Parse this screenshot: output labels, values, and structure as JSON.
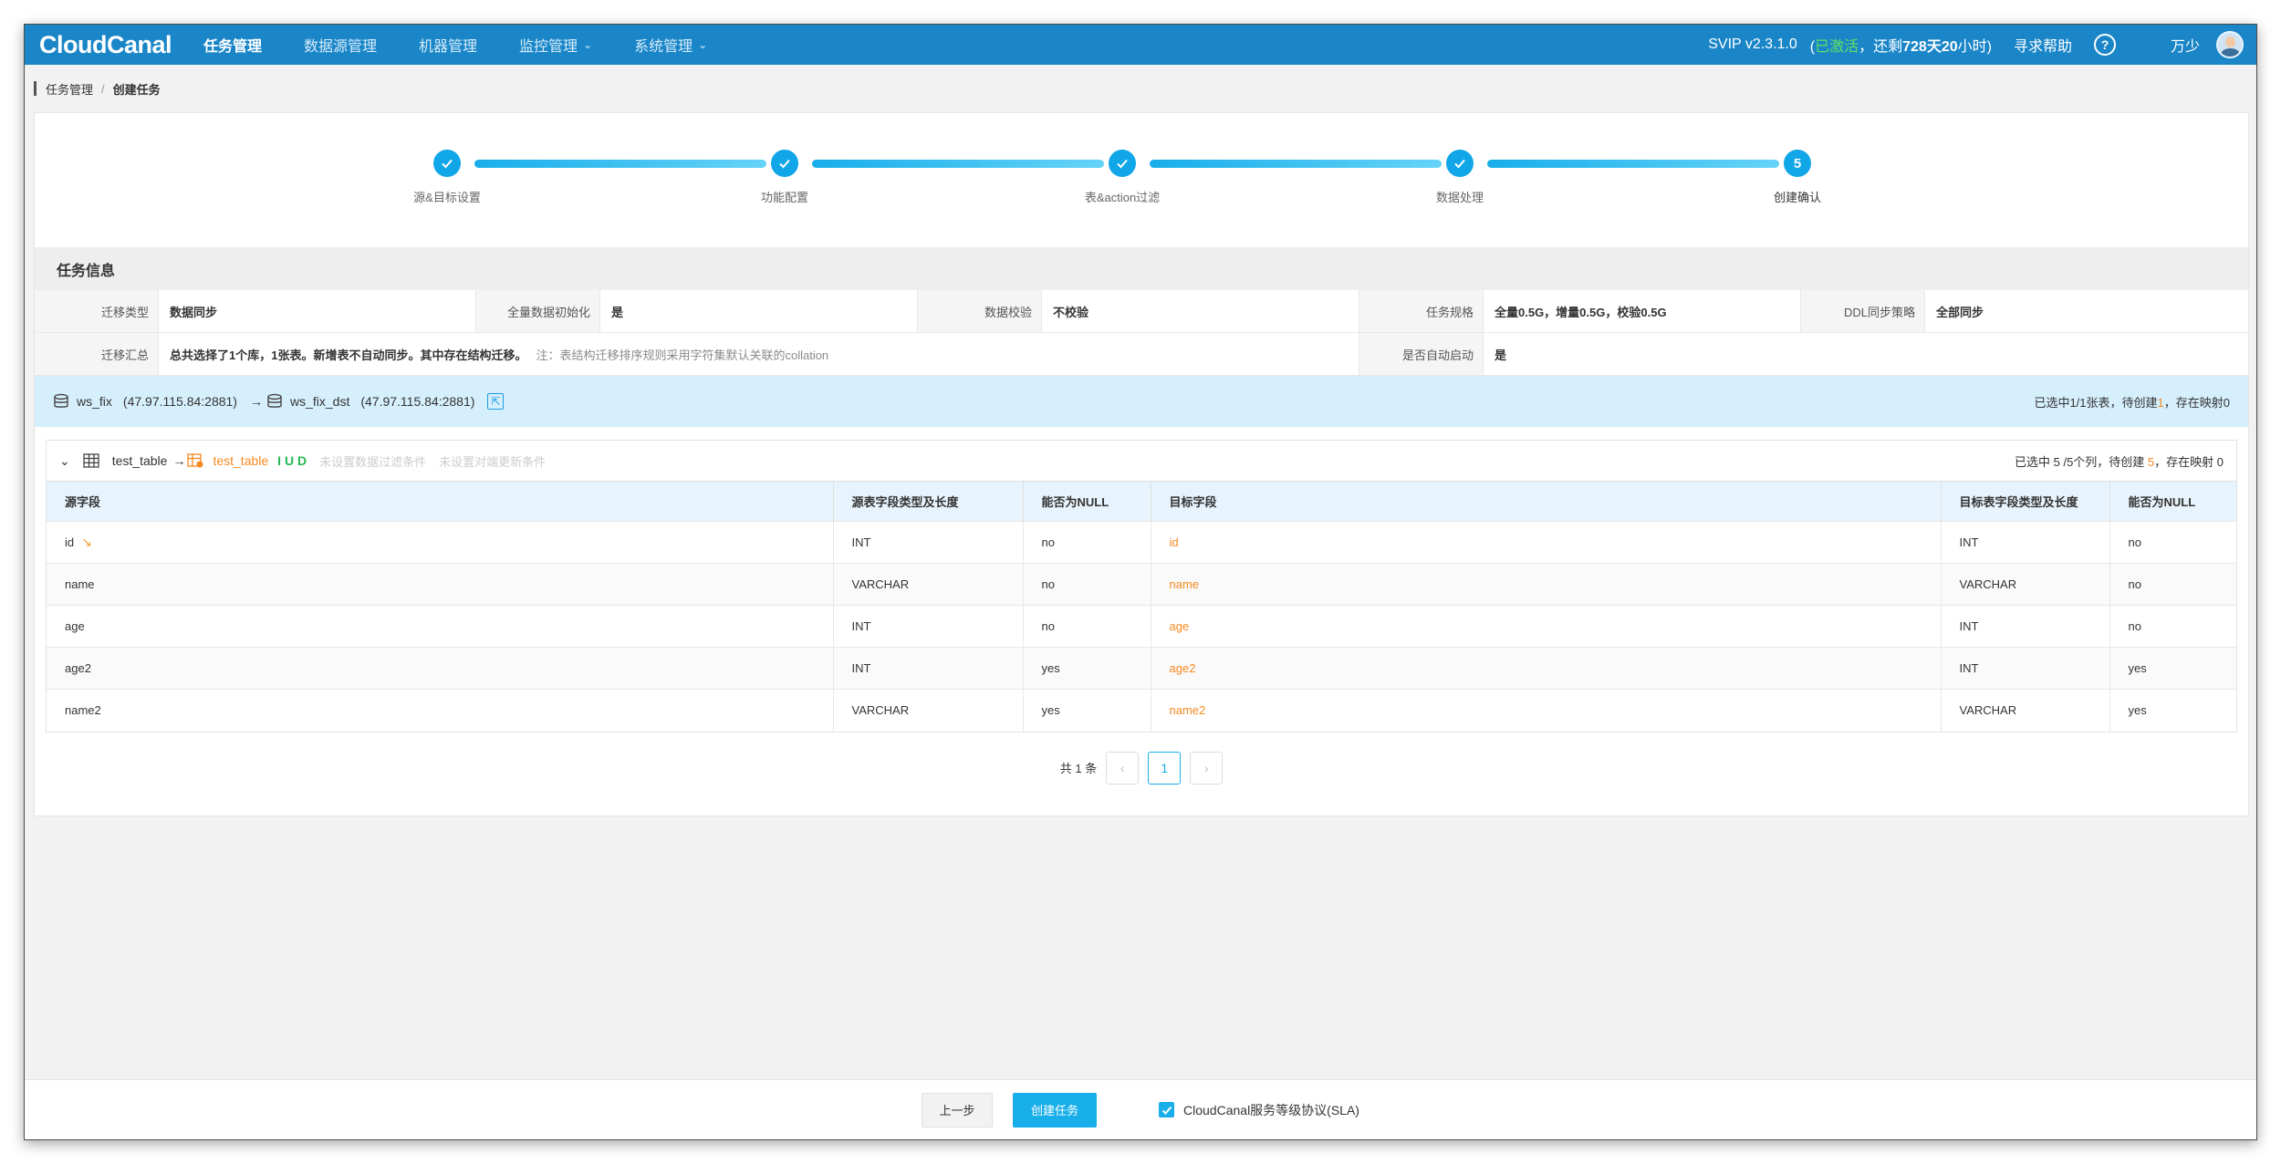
{
  "nav": {
    "logo": "CloudCanal",
    "items": [
      {
        "label": "任务管理",
        "active": true,
        "dropdown": false
      },
      {
        "label": "数据源管理",
        "active": false,
        "dropdown": false
      },
      {
        "label": "机器管理",
        "active": false,
        "dropdown": false
      },
      {
        "label": "监控管理",
        "active": false,
        "dropdown": true
      },
      {
        "label": "系统管理",
        "active": false,
        "dropdown": true
      }
    ],
    "version": "SVIP v2.3.1.0",
    "license_open": "(",
    "license_status": "已激活",
    "license_mid": "，还剩",
    "license_days": "728天20",
    "license_end": "小时)",
    "help": "寻求帮助",
    "help_icon": "?",
    "user": "万少"
  },
  "breadcrumb": {
    "parent": "任务管理",
    "separator": "/",
    "current": "创建任务"
  },
  "steps": [
    {
      "label": "源&目标设置",
      "done": true,
      "num": ""
    },
    {
      "label": "功能配置",
      "done": true,
      "num": ""
    },
    {
      "label": "表&action过滤",
      "done": true,
      "num": ""
    },
    {
      "label": "数据处理",
      "done": true,
      "num": ""
    },
    {
      "label": "创建确认",
      "done": false,
      "num": "5"
    }
  ],
  "task_info": {
    "title": "任务信息",
    "row1": [
      {
        "key": "迁移类型",
        "value": "数据同步"
      },
      {
        "key": "全量数据初始化",
        "value": "是"
      },
      {
        "key": "数据校验",
        "value": "不校验"
      },
      {
        "key": "任务规格",
        "value": "全量0.5G，增量0.5G，校验0.5G"
      },
      {
        "key": "DDL同步策略",
        "value": "全部同步"
      }
    ],
    "summary_key": "迁移汇总",
    "summary_value": "总共选择了1个库，1张表。新增表不自动同步。其中存在结构迁移。",
    "summary_note": "注：表结构迁移排序规则采用字符集默认关联的collation",
    "auto_start_key": "是否自动启动",
    "auto_start_value": "是"
  },
  "db_banner": {
    "source": "ws_fix",
    "source_addr": "(47.97.115.84:2881)",
    "arrow": "→",
    "target": "ws_fix_dst",
    "target_addr": "(47.97.115.84:2881)",
    "sync_icon": "⇱",
    "summary_prefix": "已选中1/1张表，待创建",
    "summary_pending": "1",
    "summary_suffix": "，存在映射0"
  },
  "table_bar": {
    "collapse_icon": "⌄",
    "source_table": "test_table",
    "arrow": "→",
    "target_table": "test_table",
    "actions": "I U D",
    "filter_hint": "未设置数据过滤条件",
    "update_hint": "未设置对端更新条件",
    "summary_prefix": "已选中 5 /5个列，待创建",
    "summary_pending": "5",
    "summary_suffix": "，存在映射 0"
  },
  "columns": {
    "headers": [
      "源字段",
      "源表字段类型及长度",
      "能否为NULL",
      "目标字段",
      "目标表字段类型及长度",
      "能否为NULL"
    ],
    "rows": [
      {
        "src": "id",
        "src_type": "INT",
        "src_null": "no",
        "tgt": "id",
        "tgt_type": "INT",
        "tgt_null": "no",
        "pk": true
      },
      {
        "src": "name",
        "src_type": "VARCHAR",
        "src_null": "no",
        "tgt": "name",
        "tgt_type": "VARCHAR",
        "tgt_null": "no",
        "pk": false
      },
      {
        "src": "age",
        "src_type": "INT",
        "src_null": "no",
        "tgt": "age",
        "tgt_type": "INT",
        "tgt_null": "no",
        "pk": false
      },
      {
        "src": "age2",
        "src_type": "INT",
        "src_null": "yes",
        "tgt": "age2",
        "tgt_type": "INT",
        "tgt_null": "yes",
        "pk": false
      },
      {
        "src": "name2",
        "src_type": "VARCHAR",
        "src_null": "yes",
        "tgt": "name2",
        "tgt_type": "VARCHAR",
        "tgt_null": "yes",
        "pk": false
      }
    ]
  },
  "pagination": {
    "total": "共 1 条",
    "prev": "‹",
    "current": "1",
    "next": "›"
  },
  "footer": {
    "prev": "上一步",
    "create": "创建任务",
    "sla": "CloudCanal服务等级协议(SLA)",
    "sla_checked": true
  },
  "colors": {
    "nav": "#1a86c8",
    "accent": "#18aeea",
    "orange": "#f6891f",
    "green": "#25b74f"
  }
}
